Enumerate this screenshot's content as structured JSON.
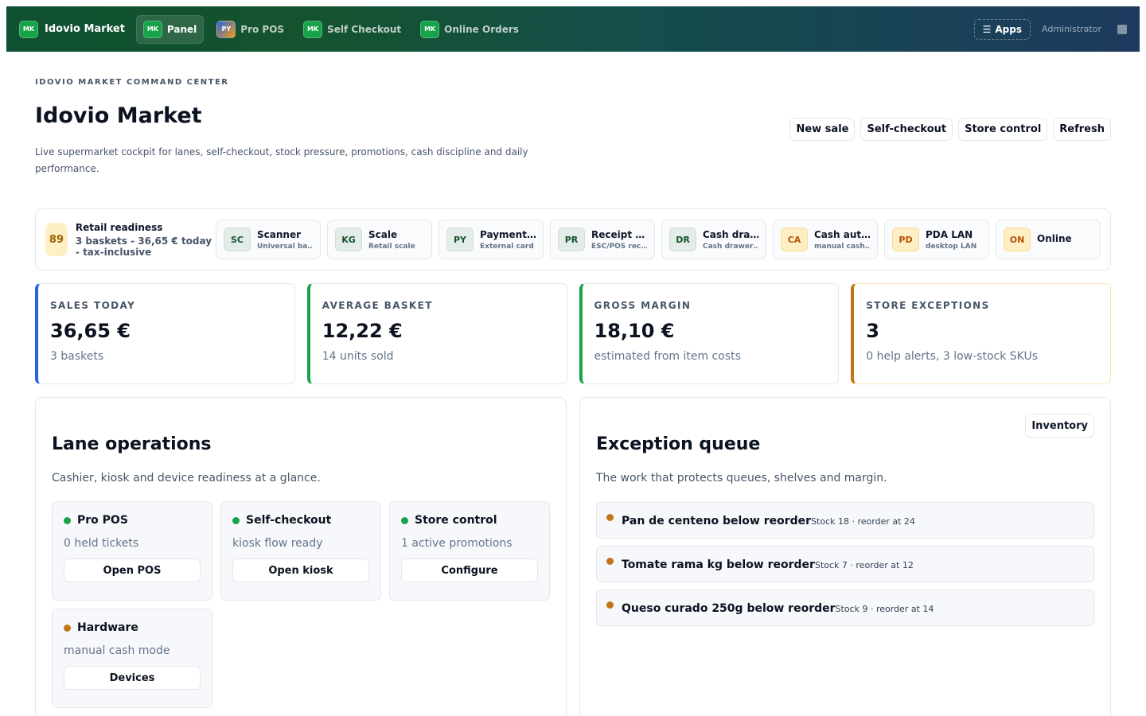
{
  "topbar": {
    "brand_abbr": "MK",
    "brand_name": "Idovio Market",
    "tabs": [
      {
        "abbr": "MK",
        "label": "Panel",
        "active": true
      },
      {
        "abbr": "PY",
        "label": "Pro POS",
        "active": false
      },
      {
        "abbr": "MK",
        "label": "Self Checkout",
        "active": false
      },
      {
        "abbr": "MK",
        "label": "Online Orders",
        "active": false
      }
    ],
    "apps_label": "Apps",
    "apps_icon": "menu-icon",
    "user_label": "Administrator"
  },
  "header": {
    "eyebrow": "IDOVIO MARKET COMMAND CENTER",
    "title": "Idovio Market",
    "subtitle": "Live supermarket cockpit for lanes, self-checkout, stock pressure, promotions, cash discipline and daily performance."
  },
  "actions": [
    "New sale",
    "Self-checkout",
    "Store control",
    "Refresh"
  ],
  "readiness": {
    "score": "89",
    "title": "Retail readiness",
    "summary": "3 baskets - 36,65 € today - tax-inclusive",
    "devices": [
      {
        "abbr": "SC",
        "name": "Scanner",
        "sub": "Universal barcode",
        "status": "ok"
      },
      {
        "abbr": "KG",
        "name": "Scale",
        "sub": "Retail scale",
        "status": "ok"
      },
      {
        "abbr": "PY",
        "name": "Payment terminal",
        "sub": "External card",
        "status": "ok"
      },
      {
        "abbr": "PR",
        "name": "Receipt printer",
        "sub": "ESC/POS receipt",
        "status": "ok"
      },
      {
        "abbr": "DR",
        "name": "Cash drawer",
        "sub": "Cash drawer kick",
        "status": "ok"
      },
      {
        "abbr": "CA",
        "name": "Cash automation",
        "sub": "manual cash mode",
        "status": "warn"
      },
      {
        "abbr": "PD",
        "name": "PDA LAN",
        "sub": "desktop LAN",
        "status": "warn"
      },
      {
        "abbr": "ON",
        "name": "Online",
        "sub": "",
        "status": "warn"
      }
    ]
  },
  "kpis": [
    {
      "label": "SALES TODAY",
      "value": "36,65 €",
      "sub": "3 baskets",
      "accent": "#2563eb"
    },
    {
      "label": "AVERAGE BASKET",
      "value": "12,22 €",
      "sub": "14 units sold",
      "accent": "#16a34a"
    },
    {
      "label": "GROSS MARGIN",
      "value": "18,10 €",
      "sub": "estimated from item costs",
      "accent": "#16a34a"
    },
    {
      "label": "STORE EXCEPTIONS",
      "value": "3",
      "sub": "0 help alerts, 3 low-stock SKUs",
      "accent": "#c27617"
    }
  ],
  "lanes": {
    "title": "Lane operations",
    "subtitle": "Cashier, kiosk and device readiness at a glance.",
    "items": [
      {
        "name": "Pro POS",
        "sub": "0 held tickets",
        "button": "Open POS",
        "status": "ok"
      },
      {
        "name": "Self-checkout",
        "sub": "kiosk flow ready",
        "button": "Open kiosk",
        "status": "ok"
      },
      {
        "name": "Store control",
        "sub": "1 active promotions",
        "button": "Configure",
        "status": "ok"
      },
      {
        "name": "Hardware",
        "sub": "manual cash mode",
        "button": "Devices",
        "status": "warn"
      }
    ]
  },
  "exceptions": {
    "title": "Exception queue",
    "subtitle": "The work that protects queues, shelves and margin.",
    "button": "Inventory",
    "items": [
      {
        "title": "Pan de centeno below reorder",
        "meta": "Stock 18 · reorder at 24"
      },
      {
        "title": "Tomate rama kg below reorder",
        "meta": "Stock 7 · reorder at 12"
      },
      {
        "title": "Queso curado 250g below reorder",
        "meta": "Stock 9 · reorder at 14"
      }
    ]
  }
}
